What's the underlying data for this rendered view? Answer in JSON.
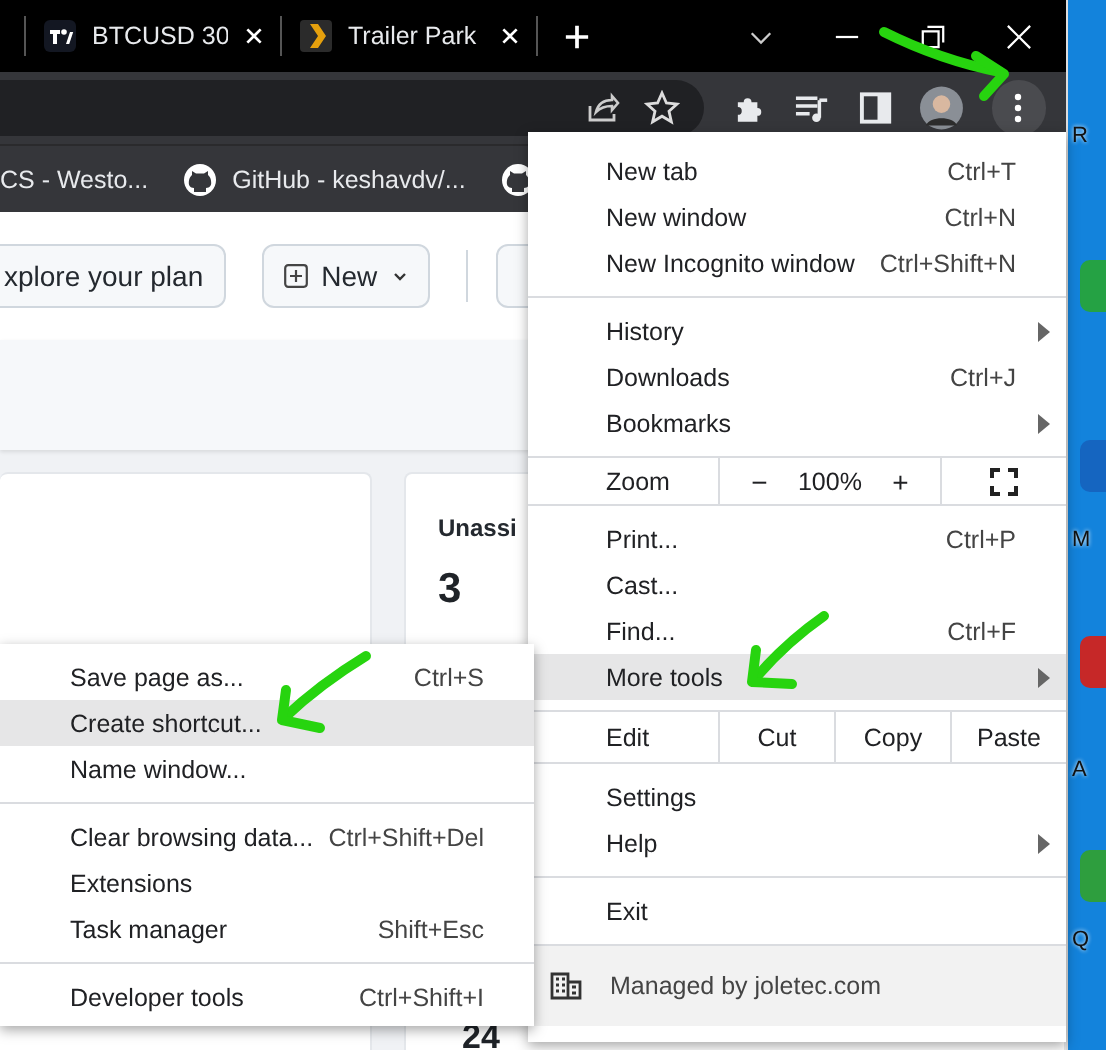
{
  "tabs": [
    {
      "title": "BTCUSD 30",
      "kind": "chart",
      "selected": false
    },
    {
      "title": "Trailer Park",
      "kind": "play",
      "selected": false
    }
  ],
  "bookmarks": [
    {
      "title": "CS - Westo...",
      "kind": "plain"
    },
    {
      "title": "GitHub - keshavdv/...",
      "kind": "github"
    },
    {
      "kind": "github"
    }
  ],
  "page": {
    "buttons": [
      {
        "label": "xplore your plan",
        "kind": "text"
      },
      {
        "label": "New",
        "kind": "new"
      },
      {
        "kind": "partial"
      }
    ],
    "card": {
      "title": "Unassi",
      "count": "3",
      "count_2": "24"
    }
  },
  "menu": {
    "sections": [
      [
        {
          "kind": "item",
          "label": "New tab",
          "shortcut": "Ctrl+T",
          "submenu": false,
          "highlighted": false
        },
        {
          "kind": "item",
          "label": "New window",
          "shortcut": "Ctrl+N",
          "submenu": false,
          "highlighted": false
        },
        {
          "kind": "item",
          "label": "New Incognito window",
          "shortcut": "Ctrl+Shift+N",
          "submenu": false,
          "highlighted": false
        }
      ],
      [
        {
          "kind": "item",
          "label": "History",
          "submenu": true,
          "highlighted": false
        },
        {
          "kind": "item",
          "label": "Downloads",
          "shortcut": "Ctrl+J",
          "submenu": false,
          "highlighted": false
        },
        {
          "kind": "item",
          "label": "Bookmarks",
          "submenu": true,
          "highlighted": false
        }
      ],
      [
        {
          "kind": "zoom",
          "label": "Zoom",
          "minus": "−",
          "value": "100%",
          "plus": "+"
        }
      ],
      [
        {
          "kind": "item",
          "label": "Print...",
          "shortcut": "Ctrl+P",
          "submenu": false,
          "highlighted": false
        },
        {
          "kind": "item",
          "label": "Cast...",
          "submenu": false,
          "highlighted": false
        },
        {
          "kind": "item",
          "label": "Find...",
          "shortcut": "Ctrl+F",
          "submenu": false,
          "highlighted": false
        },
        {
          "kind": "item",
          "label": "More tools",
          "submenu": true,
          "highlighted": true
        }
      ],
      [
        {
          "kind": "edit",
          "label": "Edit",
          "actions": [
            "Cut",
            "Copy",
            "Paste"
          ]
        }
      ],
      [
        {
          "kind": "item",
          "label": "Settings",
          "submenu": false,
          "highlighted": false
        },
        {
          "kind": "item",
          "label": "Help",
          "submenu": true,
          "highlighted": false
        }
      ],
      [
        {
          "kind": "item",
          "label": "Exit",
          "submenu": false,
          "highlighted": false
        }
      ]
    ],
    "footer": "Managed by joletec.com"
  },
  "submenu": {
    "sections": [
      [
        {
          "kind": "item",
          "label": "Save page as...",
          "shortcut": "Ctrl+S",
          "submenu": false,
          "highlighted": false
        },
        {
          "kind": "item",
          "label": "Create shortcut...",
          "submenu": false,
          "highlighted": true
        },
        {
          "kind": "item",
          "label": "Name window...",
          "submenu": false,
          "highlighted": false
        }
      ],
      [
        {
          "kind": "item",
          "label": "Clear browsing data...",
          "shortcut": "Ctrl+Shift+Del",
          "submenu": false,
          "highlighted": false
        },
        {
          "kind": "item",
          "label": "Extensions",
          "submenu": false,
          "highlighted": false
        },
        {
          "kind": "item",
          "label": "Task manager",
          "shortcut": "Shift+Esc",
          "submenu": false,
          "highlighted": false
        }
      ],
      [
        {
          "kind": "item",
          "label": "Developer tools",
          "shortcut": "Ctrl+Shift+I",
          "submenu": false,
          "highlighted": false
        }
      ]
    ]
  },
  "desktop": {
    "labels": [
      "R",
      "M",
      "A",
      "Q"
    ]
  }
}
